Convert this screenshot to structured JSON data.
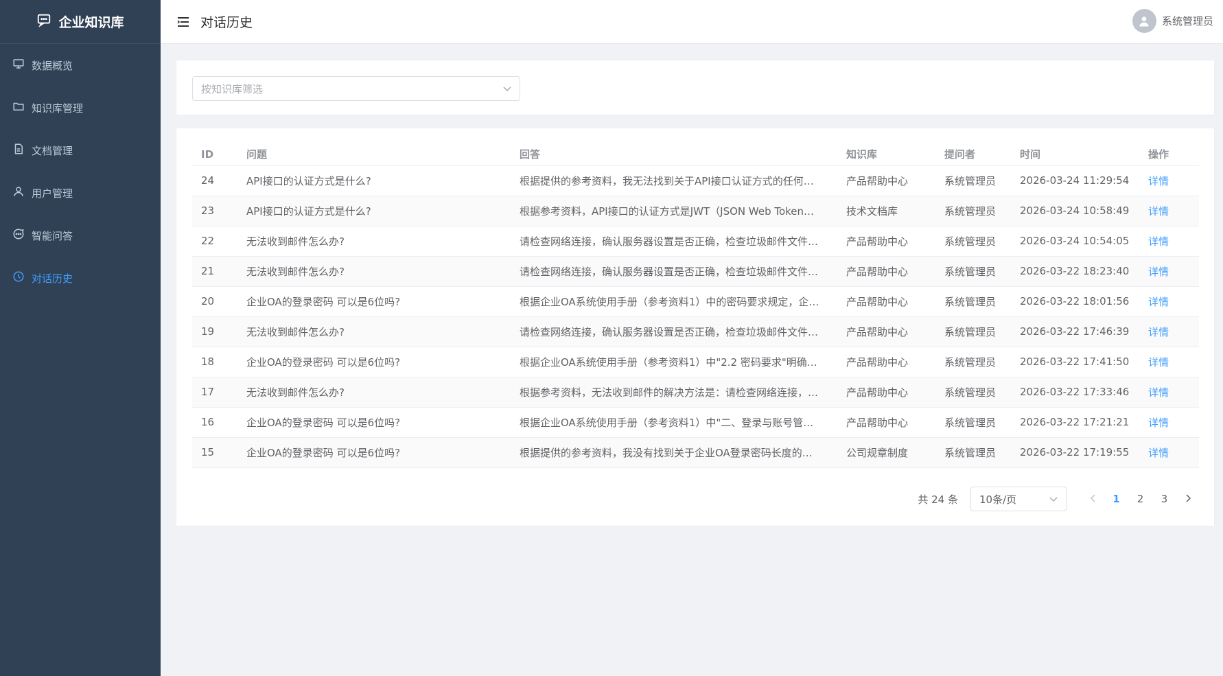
{
  "app": {
    "brand": "企业知识库"
  },
  "sidebar": {
    "items": [
      {
        "label": "数据概览",
        "icon": "monitor-icon"
      },
      {
        "label": "知识库管理",
        "icon": "folder-icon"
      },
      {
        "label": "文档管理",
        "icon": "document-icon"
      },
      {
        "label": "用户管理",
        "icon": "user-icon"
      },
      {
        "label": "智能问答",
        "icon": "chat-icon"
      },
      {
        "label": "对话历史",
        "icon": "clock-icon",
        "active": true
      }
    ]
  },
  "header": {
    "title": "对话历史",
    "user": "系统管理员"
  },
  "filter": {
    "placeholder": "按知识库筛选"
  },
  "table": {
    "columns": [
      "ID",
      "问题",
      "回答",
      "知识库",
      "提问者",
      "时间",
      "操作"
    ],
    "action_label": "详情",
    "rows": [
      {
        "id": "24",
        "question": "API接口的认证方式是什么?",
        "answer": "根据提供的参考资料，我无法找到关于API接口认证方式的任何…",
        "kb": "产品帮助中心",
        "asker": "系统管理员",
        "time": "2026-03-24 11:29:54"
      },
      {
        "id": "23",
        "question": "API接口的认证方式是什么?",
        "answer": "根据参考资料，API接口的认证方式是JWT（JSON Web Token…",
        "kb": "技术文档库",
        "asker": "系统管理员",
        "time": "2026-03-24 10:58:49"
      },
      {
        "id": "22",
        "question": "无法收到邮件怎么办?",
        "answer": "请检查网络连接，确认服务器设置是否正确，检查垃圾邮件文件…",
        "kb": "产品帮助中心",
        "asker": "系统管理员",
        "time": "2026-03-24 10:54:05"
      },
      {
        "id": "21",
        "question": "无法收到邮件怎么办?",
        "answer": "请检查网络连接，确认服务器设置是否正确，检查垃圾邮件文件…",
        "kb": "产品帮助中心",
        "asker": "系统管理员",
        "time": "2026-03-22 18:23:40"
      },
      {
        "id": "20",
        "question": "企业OA的登录密码 可以是6位吗?",
        "answer": "根据企业OA系统使用手册（参考资料1）中的密码要求规定，企…",
        "kb": "产品帮助中心",
        "asker": "系统管理员",
        "time": "2026-03-22 18:01:56"
      },
      {
        "id": "19",
        "question": "无法收到邮件怎么办?",
        "answer": "请检查网络连接，确认服务器设置是否正确，检查垃圾邮件文件…",
        "kb": "产品帮助中心",
        "asker": "系统管理员",
        "time": "2026-03-22 17:46:39"
      },
      {
        "id": "18",
        "question": "企业OA的登录密码 可以是6位吗?",
        "answer": "根据企业OA系统使用手册（参考资料1）中\"2.2 密码要求\"明确…",
        "kb": "产品帮助中心",
        "asker": "系统管理员",
        "time": "2026-03-22 17:41:50"
      },
      {
        "id": "17",
        "question": "无法收到邮件怎么办?",
        "answer": "根据参考资料，无法收到邮件的解决方法是：请检查网络连接，…",
        "kb": "产品帮助中心",
        "asker": "系统管理员",
        "time": "2026-03-22 17:33:46"
      },
      {
        "id": "16",
        "question": "企业OA的登录密码 可以是6位吗?",
        "answer": "根据企业OA系统使用手册（参考资料1）中\"二、登录与账号管…",
        "kb": "产品帮助中心",
        "asker": "系统管理员",
        "time": "2026-03-22 17:21:21"
      },
      {
        "id": "15",
        "question": "企业OA的登录密码 可以是6位吗?",
        "answer": "根据提供的参考资料，我没有找到关于企业OA登录密码长度的…",
        "kb": "公司规章制度",
        "asker": "系统管理员",
        "time": "2026-03-22 17:19:55"
      }
    ]
  },
  "pagination": {
    "total_text": "共 24 条",
    "page_size": "10条/页",
    "pages": [
      "1",
      "2",
      "3"
    ],
    "current": "1"
  },
  "colors": {
    "sidebar_bg": "#304156",
    "accent": "#409eff"
  }
}
